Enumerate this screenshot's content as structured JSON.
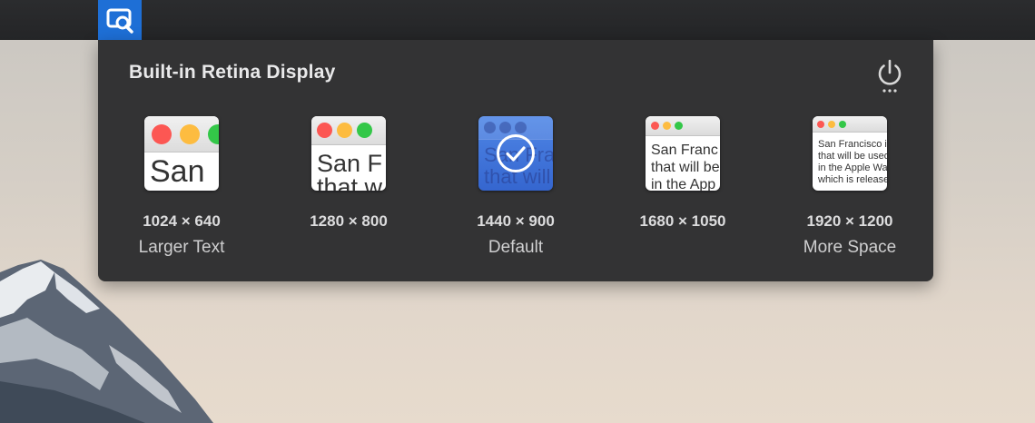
{
  "menubar": {
    "app_icon": "display-search-icon",
    "accent": "#1e6fd6"
  },
  "panel": {
    "title": "Built-in Retina Display",
    "power_icon": "power-icon"
  },
  "options": [
    {
      "resolution": "1024 × 640",
      "label": "Larger Text",
      "preview_lines": [
        "San"
      ],
      "selected": false
    },
    {
      "resolution": "1280 × 800",
      "label": "",
      "preview_lines": [
        "San F",
        "that w"
      ],
      "selected": false
    },
    {
      "resolution": "1440 × 900",
      "label": "Default",
      "preview_lines": [
        "San Fra",
        "that will"
      ],
      "selected": true
    },
    {
      "resolution": "1680 × 1050",
      "label": "",
      "preview_lines": [
        "San Franc",
        "that will be",
        "in the App"
      ],
      "selected": false
    },
    {
      "resolution": "1920 × 1200",
      "label": "More Space",
      "preview_lines": [
        "San Francisco i",
        "that will be used",
        "in the Apple Wa",
        "which is release"
      ],
      "selected": false
    }
  ]
}
